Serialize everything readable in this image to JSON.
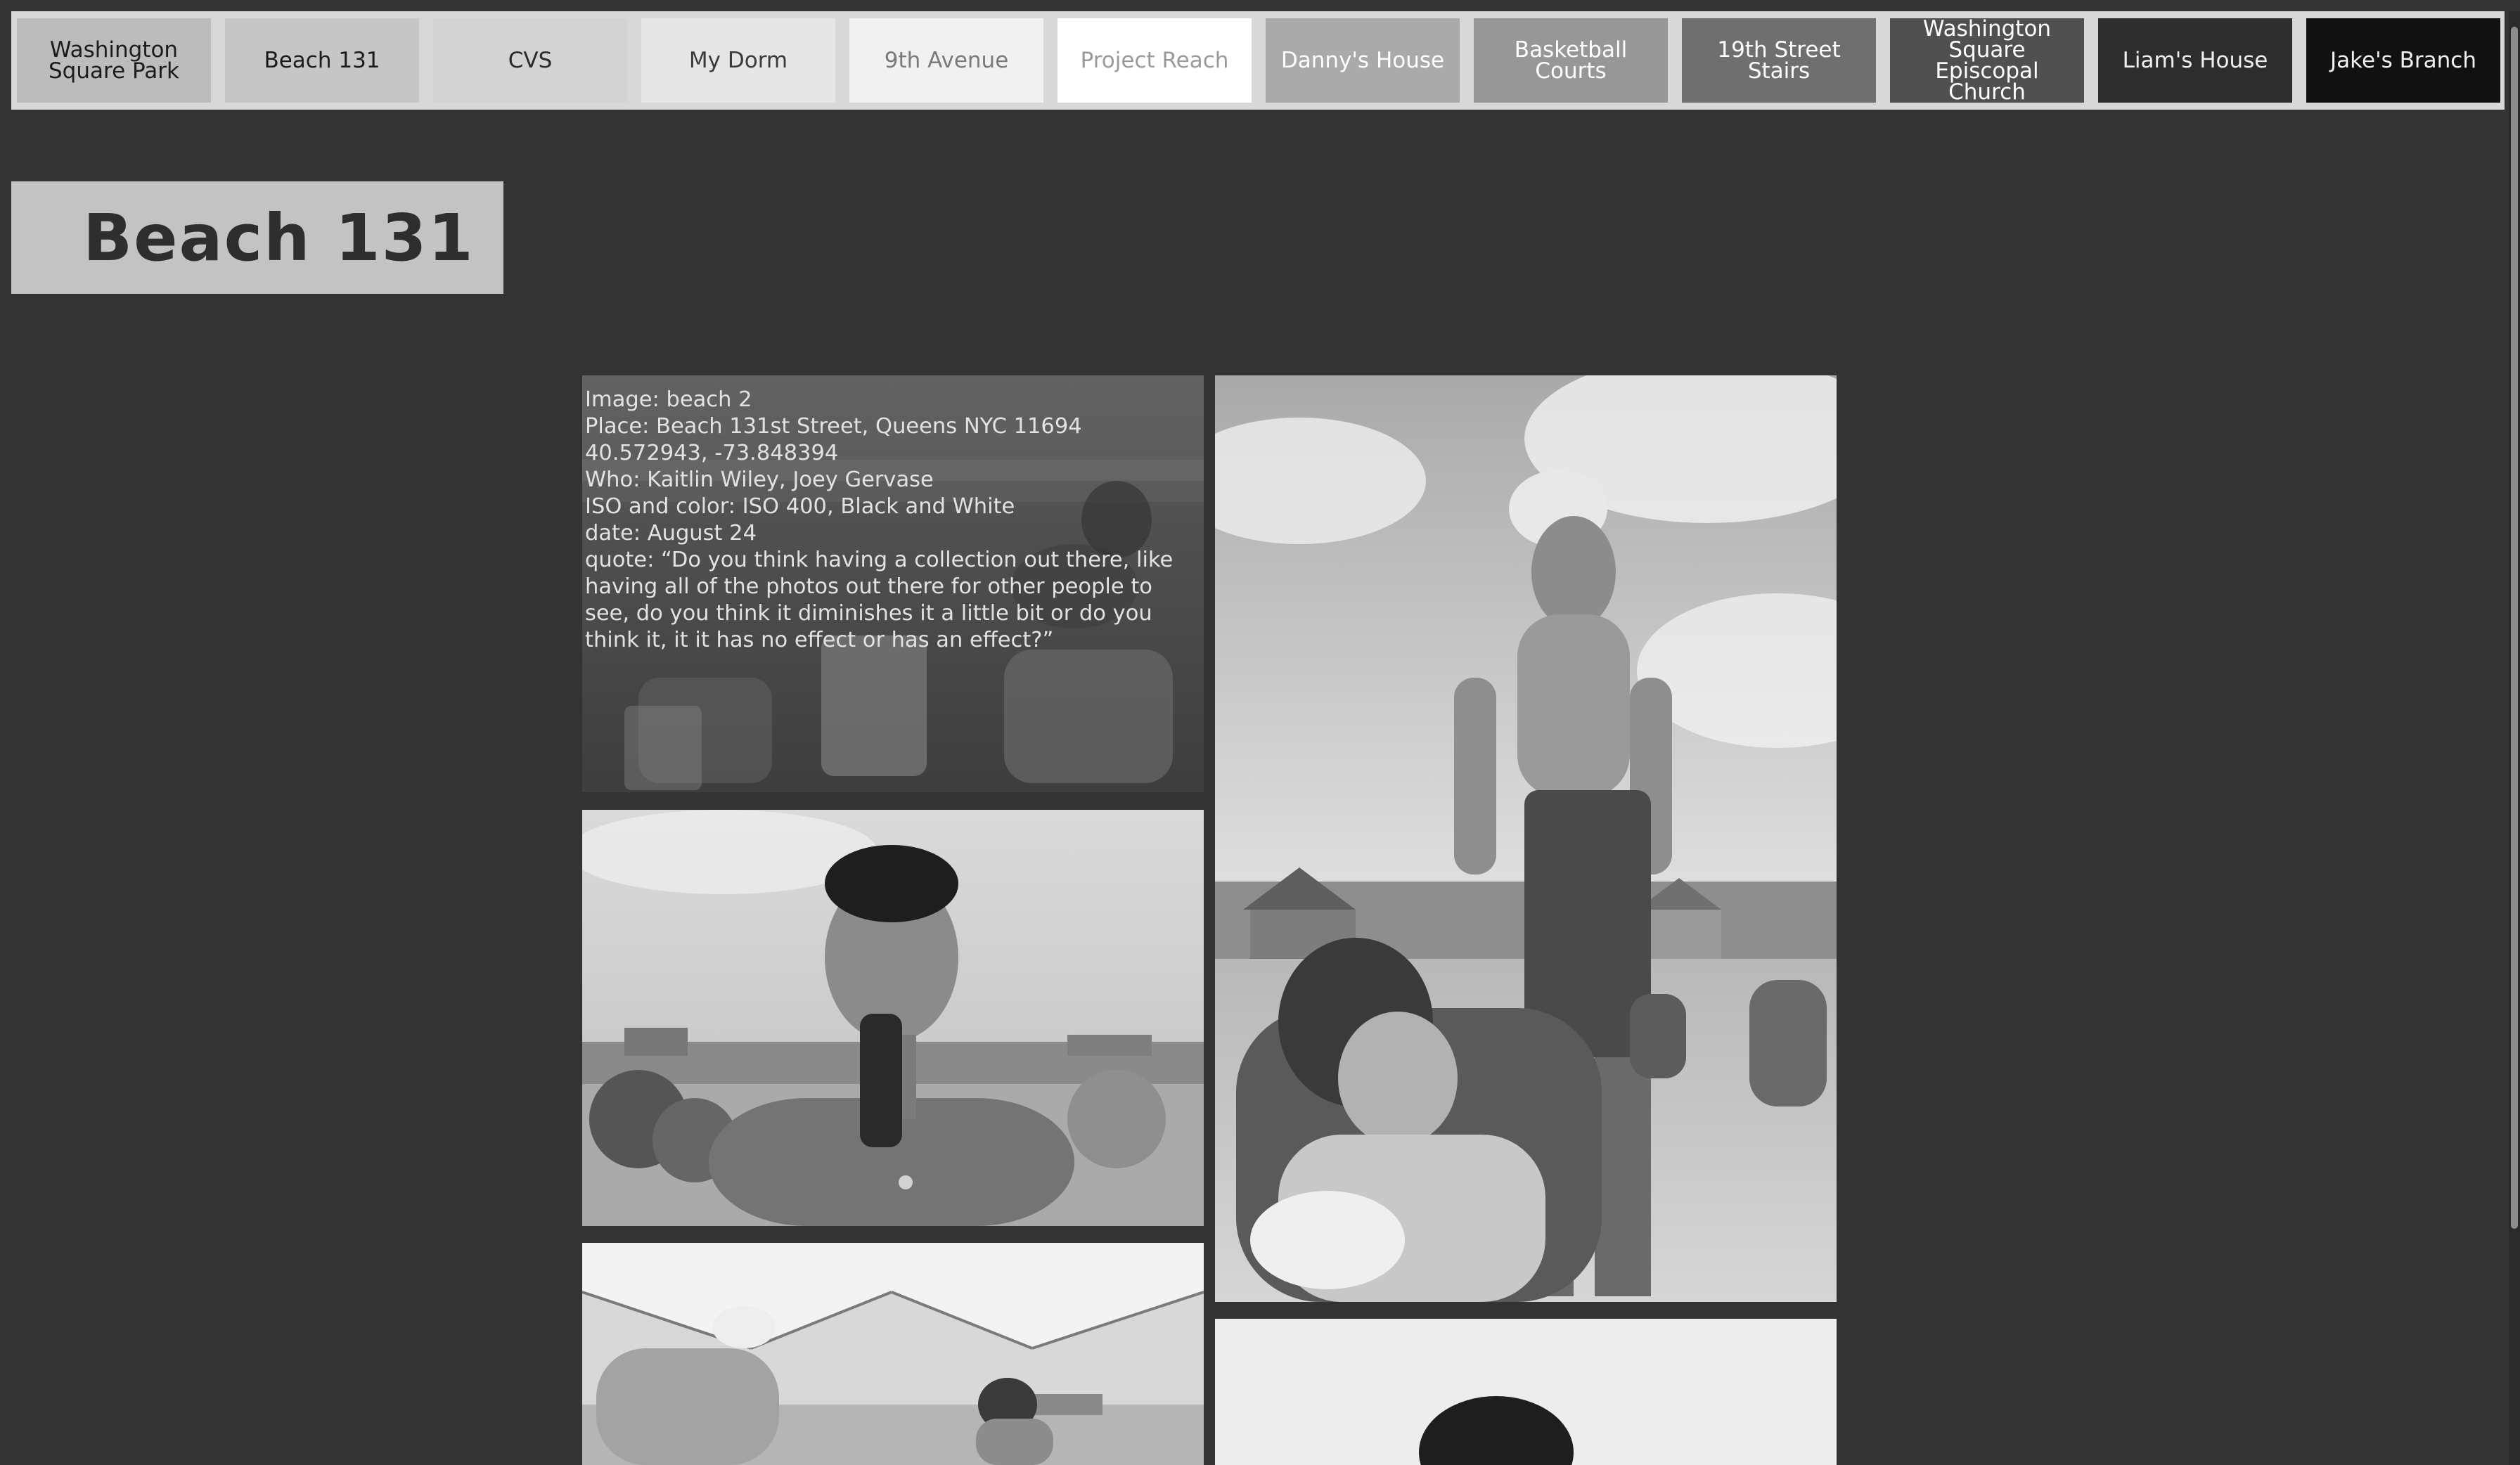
{
  "nav": {
    "items": [
      {
        "label": "Washington Square Park",
        "bg": "#bcbcbc",
        "fg": "#1c1c1c"
      },
      {
        "label": "Beach 131",
        "bg": "#c6c6c6",
        "fg": "#1c1c1c"
      },
      {
        "label": "CVS",
        "bg": "#d3d3d3",
        "fg": "#2a2a2a"
      },
      {
        "label": "My Dorm",
        "bg": "#e6e6e6",
        "fg": "#3a3a3a"
      },
      {
        "label": "9th Avenue",
        "bg": "#f1f1f1",
        "fg": "#7a7a7a"
      },
      {
        "label": "Project Reach",
        "bg": "#ffffff",
        "fg": "#9a9a9a"
      },
      {
        "label": "Danny's House",
        "bg": "#aaaaaa",
        "fg": "#ffffff"
      },
      {
        "label": "Basketball Courts",
        "bg": "#979797",
        "fg": "#ffffff"
      },
      {
        "label": "19th Street Stairs",
        "bg": "#6f6f6f",
        "fg": "#ffffff"
      },
      {
        "label": "Washington Square Episcopal Church",
        "bg": "#505050",
        "fg": "#ffffff"
      },
      {
        "label": "Liam's House",
        "bg": "#2d2d2d",
        "fg": "#f0f0f0"
      },
      {
        "label": "Jake's Branch",
        "bg": "#111111",
        "fg": "#f0f0f0"
      }
    ]
  },
  "page": {
    "title": "Beach 131"
  },
  "caption": {
    "lines": [
      "Image: beach 2",
      "Place: Beach 131st Street, Queens NYC 11694",
      "40.572943, -73.848394",
      "Who: Kaitlin Wiley, Joey Gervase",
      "ISO and color: ISO 400, Black and White",
      "date: August 24",
      "quote: “Do you think having a collection out there, like",
      "having all of the photos out there for other people to",
      "see, do you think it diminishes it a little bit or do you",
      "think it, it it has no effect or has an effect?”"
    ]
  },
  "colors": {
    "background": "#333333",
    "nav_bar": "#d8d8d8",
    "title_box": "#c3c3c3"
  }
}
